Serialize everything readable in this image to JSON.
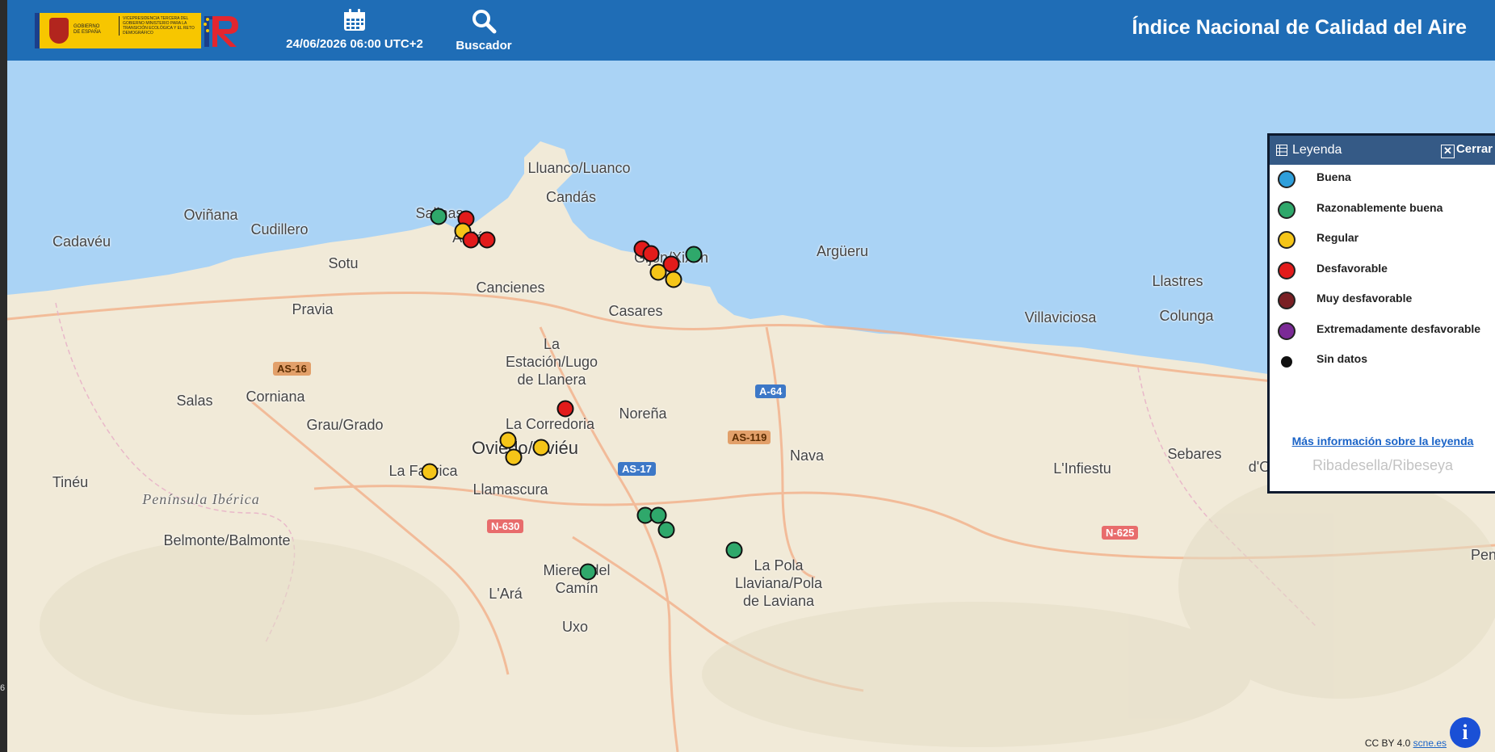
{
  "header": {
    "gov_text": "GOBIERNO DE ESPAÑA",
    "ministry_text": "VICEPRESIDENCIA TERCERA DEL GOBIERNO MINISTERIO PARA LA TRANSICIÓN ECOLÓGICA Y EL RETO DEMOGRÁFICO",
    "datetime": "24/06/2026 06:00 UTC+2",
    "search_label": "Buscador",
    "title": "Índice Nacional de Calidad del Aire",
    "calendar_icon": "calendar-icon",
    "search_icon": "magnifier-icon"
  },
  "colors": {
    "header": "#1f6db6",
    "sea": "#aad3f5",
    "buena": "#2f9fdb",
    "razonable": "#2fa86b",
    "regular": "#f5c518",
    "desfavorable": "#e21b1b",
    "muy_desfavorable": "#7a1f24",
    "extremadamente": "#7b2a96",
    "sin_datos": "#111111"
  },
  "places": [
    {
      "name": "Lluanco/Luanco"
    },
    {
      "name": "Candás"
    },
    {
      "name": "Salinas"
    },
    {
      "name": "Avilés"
    },
    {
      "name": "Oviñana"
    },
    {
      "name": "Cudillero"
    },
    {
      "name": "Cadavéu"
    },
    {
      "name": "Sotu"
    },
    {
      "name": "Cancienes"
    },
    {
      "name": "Pravia"
    },
    {
      "name": "Gijón/Xixón"
    },
    {
      "name": "Casares"
    },
    {
      "name": "Argüeru"
    },
    {
      "name": "Llastres"
    },
    {
      "name": "Villaviciosa"
    },
    {
      "name": "Colunga"
    },
    {
      "name": "La\nEstación/Lugo\nde Llanera"
    },
    {
      "name": "Salas"
    },
    {
      "name": "Corniana"
    },
    {
      "name": "Grau/Grado"
    },
    {
      "name": "La Corredoria"
    },
    {
      "name": "Noreña"
    },
    {
      "name": "Oviedo/Uviéu"
    },
    {
      "name": "La Fabrica"
    },
    {
      "name": "Tinéu"
    },
    {
      "name": "Llamascura"
    },
    {
      "name": "Península Ibérica"
    },
    {
      "name": "Belmonte/Balmonte"
    },
    {
      "name": "Nava"
    },
    {
      "name": "L'Infiestu"
    },
    {
      "name": "Sebares"
    },
    {
      "name": "Cangues\nd'Onís/Cangas\nde Onís"
    },
    {
      "name": "Mieres del\nCamín"
    },
    {
      "name": "L'Ará"
    },
    {
      "name": "La Pola\nLlaviana/Pola\nde Laviana"
    },
    {
      "name": "Uxo"
    },
    {
      "name": "Peni"
    }
  ],
  "roads": [
    {
      "label": "AS-16"
    },
    {
      "label": "A-64"
    },
    {
      "label": "AS-119"
    },
    {
      "label": "AS-17"
    },
    {
      "label": "N-630"
    },
    {
      "label": "N-625"
    }
  ],
  "stations": [
    {
      "quality": "razonable"
    },
    {
      "quality": "desfavorable"
    },
    {
      "quality": "regular"
    },
    {
      "quality": "desfavorable"
    },
    {
      "quality": "desfavorable"
    },
    {
      "quality": "desfavorable"
    },
    {
      "quality": "desfavorable"
    },
    {
      "quality": "razonable"
    },
    {
      "quality": "desfavorable"
    },
    {
      "quality": "regular"
    },
    {
      "quality": "regular"
    },
    {
      "quality": "desfavorable"
    },
    {
      "quality": "regular"
    },
    {
      "quality": "regular"
    },
    {
      "quality": "regular"
    },
    {
      "quality": "regular"
    },
    {
      "quality": "razonable"
    },
    {
      "quality": "razonable"
    },
    {
      "quality": "razonable"
    },
    {
      "quality": "razonable"
    },
    {
      "quality": "razonable"
    }
  ],
  "legend": {
    "title": "Leyenda",
    "close_label": "Cerrar",
    "items": [
      {
        "label": "Buena",
        "key": "buena"
      },
      {
        "label": "Razonablemente buena",
        "key": "razonable"
      },
      {
        "label": "Regular",
        "key": "regular"
      },
      {
        "label": "Desfavorable",
        "key": "desfavorable"
      },
      {
        "label": "Muy desfavorable",
        "key": "muy_desfavorable"
      },
      {
        "label": "Extremadamente desfavorable",
        "key": "extremadamente"
      },
      {
        "label": "Sin datos",
        "key": "sin_datos"
      }
    ],
    "more_info": "Más información sobre la leyenda",
    "behind_label": "Ribadesella/Ribeseya"
  },
  "attribution": {
    "license": "CC BY 4.0",
    "link": "scne.es"
  },
  "info_button": "i",
  "left_strip_text": "6"
}
